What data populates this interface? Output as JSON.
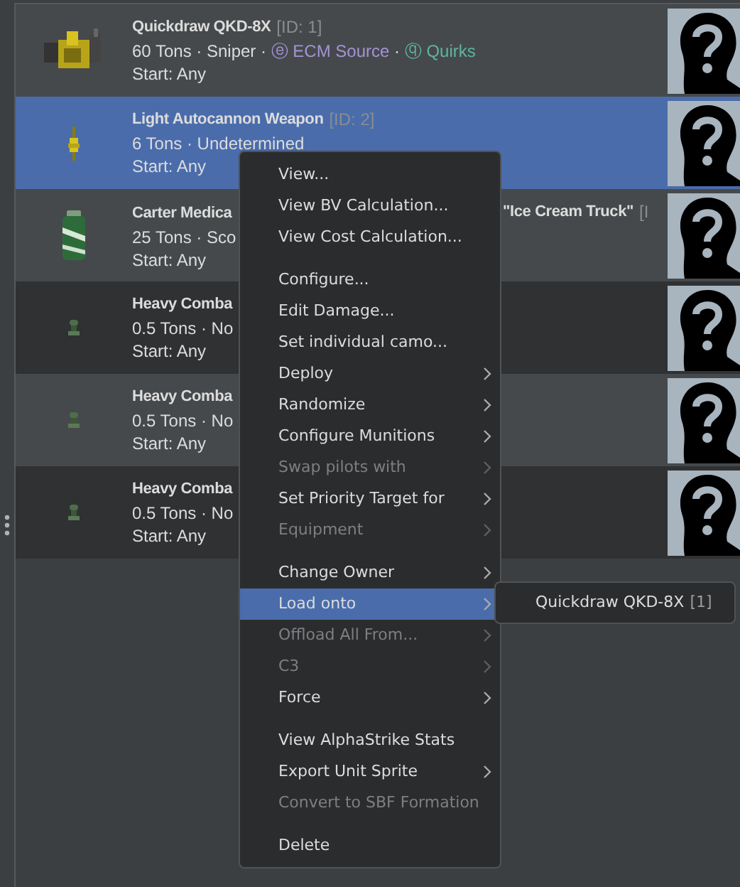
{
  "units": [
    {
      "kind": "mech",
      "name": "Quickdraw QKD-8X",
      "id": "[ID: 1]",
      "selected": false,
      "details": [
        {
          "text": "60 Tons · Sniper · "
        },
        {
          "text": "ⓔ ECM Source",
          "color": "#a393d6"
        },
        {
          "text": " · "
        },
        {
          "text": "ⓠ Quirks",
          "color": "#5db6a2"
        }
      ],
      "start": "Start: Any"
    },
    {
      "kind": "weapon",
      "name": "Light Autocannon Weapon",
      "id": "[ID: 2]",
      "selected": true,
      "details": [
        {
          "text": "6 Tons · Undetermined"
        }
      ],
      "start": "Start: Any"
    },
    {
      "kind": "canister",
      "name": "Carter Medica",
      "name_tail": "\"Ice Cream Truck\"",
      "id": "[I",
      "selected": false,
      "details": [
        {
          "text": "25 Tons · Sco"
        }
      ],
      "start": "Start: Any"
    },
    {
      "kind": "infantry",
      "name": "Heavy Comba",
      "selected": false,
      "details": [
        {
          "text": "0.5 Tons · No"
        }
      ],
      "start": "Start: Any"
    },
    {
      "kind": "infantry",
      "name": "Heavy Comba",
      "selected": false,
      "details": [
        {
          "text": "0.5 Tons · No"
        }
      ],
      "start": "Start: Any"
    },
    {
      "kind": "infantry",
      "name": "Heavy Comba",
      "selected": false,
      "details": [
        {
          "text": "0.5 Tons · No"
        }
      ],
      "start": "Start: Any"
    }
  ],
  "context_menu": [
    {
      "label": "View...",
      "submenu": false,
      "disabled": false,
      "selected": false,
      "separator_before": false
    },
    {
      "label": "View BV Calculation...",
      "submenu": false,
      "disabled": false,
      "selected": false,
      "separator_before": false
    },
    {
      "label": "View Cost Calculation...",
      "submenu": false,
      "disabled": false,
      "selected": false,
      "separator_before": false
    },
    {
      "label": "Configure...",
      "submenu": false,
      "disabled": false,
      "selected": false,
      "separator_before": true
    },
    {
      "label": "Edit Damage...",
      "submenu": false,
      "disabled": false,
      "selected": false,
      "separator_before": false
    },
    {
      "label": "Set individual camo...",
      "submenu": false,
      "disabled": false,
      "selected": false,
      "separator_before": false
    },
    {
      "label": "Deploy",
      "submenu": true,
      "disabled": false,
      "selected": false,
      "separator_before": false
    },
    {
      "label": "Randomize",
      "submenu": true,
      "disabled": false,
      "selected": false,
      "separator_before": false
    },
    {
      "label": "Configure Munitions",
      "submenu": true,
      "disabled": false,
      "selected": false,
      "separator_before": false
    },
    {
      "label": "Swap pilots with",
      "submenu": true,
      "disabled": true,
      "selected": false,
      "separator_before": false
    },
    {
      "label": "Set Priority Target for",
      "submenu": true,
      "disabled": false,
      "selected": false,
      "separator_before": false
    },
    {
      "label": "Equipment",
      "submenu": true,
      "disabled": true,
      "selected": false,
      "separator_before": false
    },
    {
      "label": "Change Owner",
      "submenu": true,
      "disabled": false,
      "selected": false,
      "separator_before": true
    },
    {
      "label": "Load onto",
      "submenu": true,
      "disabled": false,
      "selected": true,
      "separator_before": false
    },
    {
      "label": "Offload All From...",
      "submenu": true,
      "disabled": true,
      "selected": false,
      "separator_before": false
    },
    {
      "label": "C3",
      "submenu": true,
      "disabled": true,
      "selected": false,
      "separator_before": false
    },
    {
      "label": "Force",
      "submenu": true,
      "disabled": false,
      "selected": false,
      "separator_before": false
    },
    {
      "label": "View AlphaStrike Stats",
      "submenu": false,
      "disabled": false,
      "selected": false,
      "separator_before": true
    },
    {
      "label": "Export Unit Sprite",
      "submenu": true,
      "disabled": false,
      "selected": false,
      "separator_before": false
    },
    {
      "label": "Convert to SBF Formation",
      "submenu": false,
      "disabled": true,
      "selected": false,
      "separator_before": false
    },
    {
      "label": "Delete",
      "submenu": false,
      "disabled": false,
      "selected": false,
      "separator_before": true
    }
  ],
  "submenu": [
    {
      "label": "Quickdraw QKD-8X",
      "tag": "[1]"
    }
  ]
}
